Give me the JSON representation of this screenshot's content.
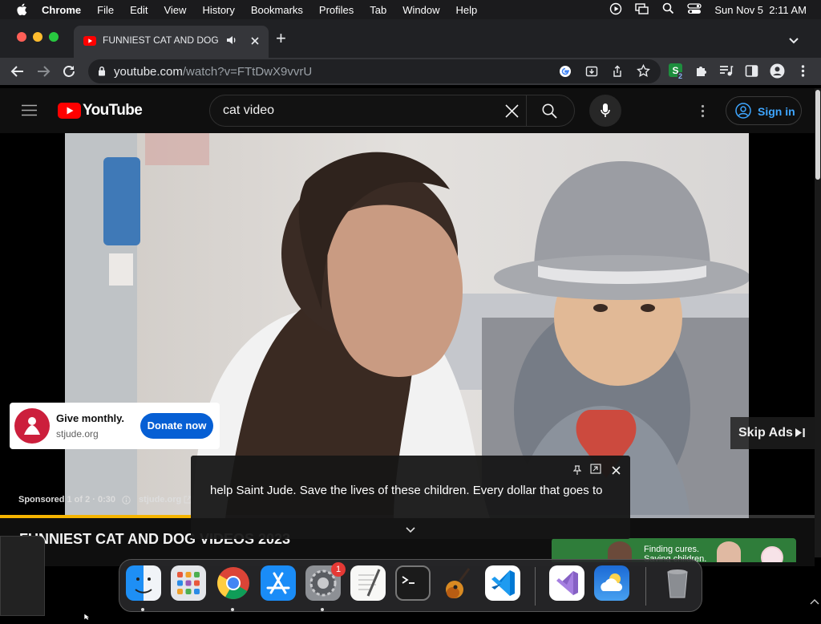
{
  "menubar": {
    "app": "Chrome",
    "items": [
      "File",
      "Edit",
      "View",
      "History",
      "Bookmarks",
      "Profiles",
      "Tab",
      "Window",
      "Help"
    ],
    "datetime": "Sun Nov 5  2:11 AM"
  },
  "browser": {
    "tab_title": "FUNNIEST CAT AND DOG VIDEOS 2023",
    "url_host": "youtube.com",
    "url_path": "/watch?v=FTtDwX9vvrU",
    "extension_badge": "2"
  },
  "youtube": {
    "logo_text": "YouTube",
    "search_value": "cat video",
    "signin_label": "Sign in"
  },
  "ad": {
    "card_title": "Give monthly.",
    "card_domain": "stjude.org",
    "donate_label": "Donate now",
    "skip_label": "Skip Ads",
    "sponsored_label": "Sponsored 1 of 2 · 0:30",
    "sponsored_domain": "stjude.org",
    "progress_fraction": 0.234
  },
  "caption": {
    "text": "help Saint Jude. Save the lives of these children. Every dollar that goes to"
  },
  "video": {
    "title": "FUNNIEST CAT AND DOG VIDEOS 2023"
  },
  "side_ad": {
    "text_line1": "Finding cures.",
    "text_line2": "Saving children."
  },
  "dock": {
    "settings_badge": "1",
    "apps": [
      "finder",
      "launchpad",
      "chrome",
      "app-store",
      "system-settings",
      "textedit",
      "terminal",
      "garageband",
      "vscode",
      "visual-studio",
      "weather",
      "trash"
    ]
  }
}
